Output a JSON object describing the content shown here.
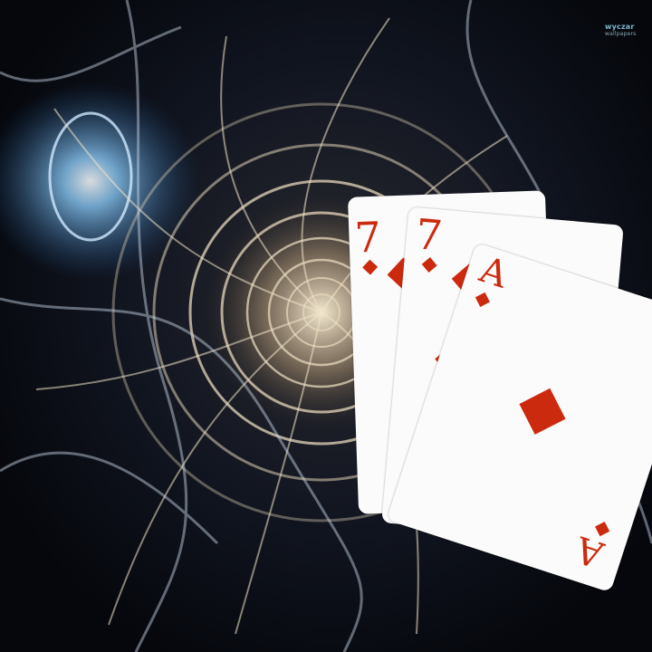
{
  "watermark": {
    "brand": "wyczar",
    "sub": "wallpapers"
  },
  "cards": [
    {
      "rank": "7",
      "suit": "diamond"
    },
    {
      "rank": "7",
      "suit": "diamond"
    },
    {
      "rank": "A",
      "suit": "diamond"
    }
  ],
  "colors": {
    "suit_red": "#cc2a0e",
    "card_face": "#fbfbfb",
    "glow_blue": "#8fd0ff",
    "swirl_cream": "#e6d7bc",
    "background": "#05070c"
  }
}
